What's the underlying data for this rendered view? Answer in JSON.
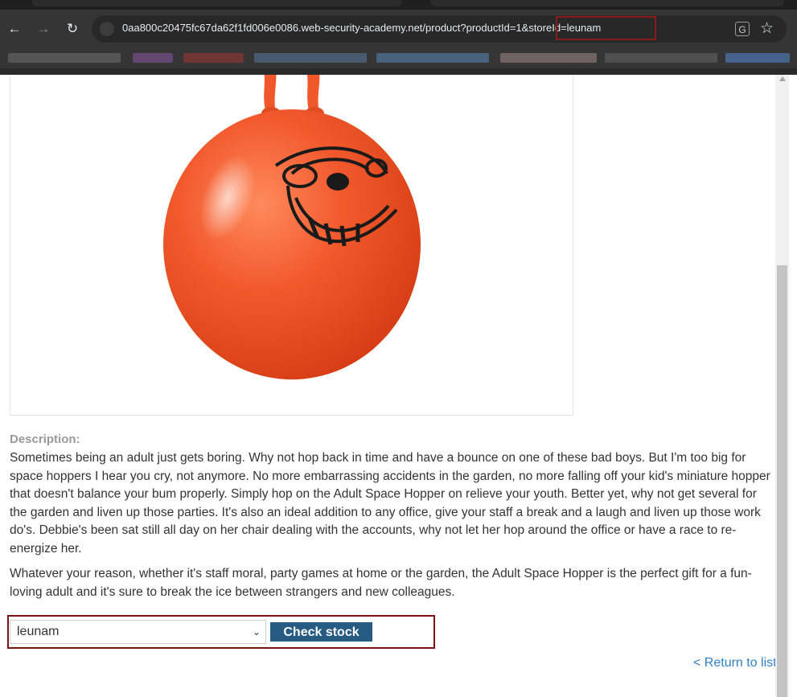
{
  "browser": {
    "url": "0aa800c20475fc67da62f1fd006e0086.web-security-academy.net/product?productId=1&storeId=leunam",
    "icons": [
      "back-icon",
      "forward-icon",
      "reload-icon",
      "site-info-icon",
      "translate-icon",
      "bookmark-star-icon"
    ]
  },
  "product": {
    "image_alt": "orange space hopper"
  },
  "description": {
    "heading": "Description:",
    "paragraph1": "Sometimes being an adult just gets boring. Why not hop back in time and have a bounce on one of these bad boys. But I'm too big for space hoppers I hear you cry, not anymore. No more embarrassing accidents in the garden, no more falling off your kid's miniature hopper that doesn't balance your bum properly. Simply hop on the Adult Space Hopper on relieve your youth. Better yet, why not get several for the garden and liven up those parties. It's also an ideal addition to any office, give your staff a break and a laugh and liven up those work do's. Debbie's been sat still all day on her chair dealing with the accounts, why not let her hop around the office or have a race to re-energize her.",
    "paragraph2": "Whatever your reason, whether it's staff moral, party games at home or the garden, the Adult Space Hopper is the perfect gift for a fun-loving adult and it's sure to break the ice between strangers and new colleagues."
  },
  "stock_check": {
    "selected_store": "leunam",
    "button_label": "Check stock"
  },
  "return_link": "< Return to list",
  "colors": {
    "button_bg": "#265b83",
    "link": "#2f82c6",
    "highlight_border": "#8b1a1a",
    "hopper_orange": "#f2542b"
  }
}
